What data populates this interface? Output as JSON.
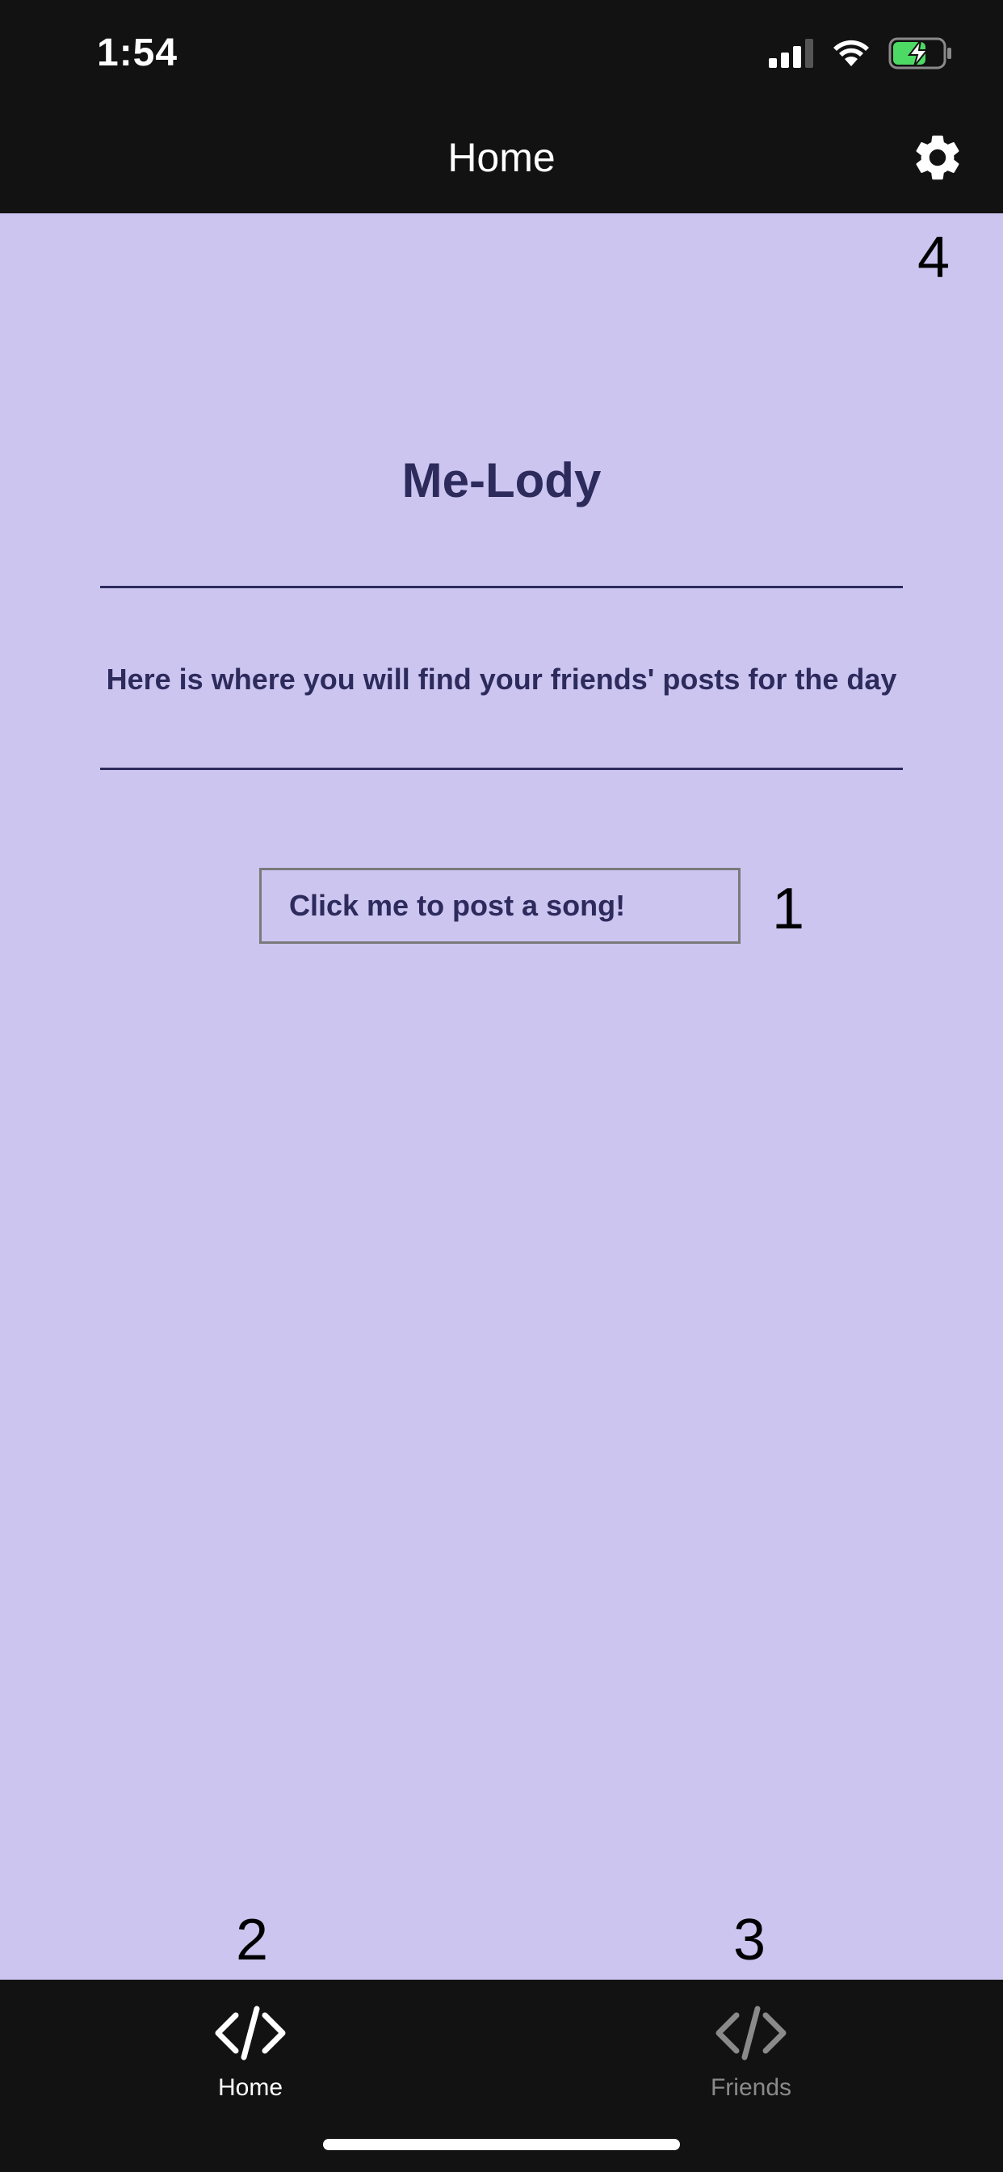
{
  "status_bar": {
    "time": "1:54",
    "icons": [
      "signal-icon",
      "wifi-icon",
      "battery-charging-icon"
    ]
  },
  "header": {
    "title": "Home",
    "settings_icon": "gear-icon"
  },
  "main": {
    "app_title": "Me-Lody",
    "subtitle": "Here is where you will find your friends' posts for the day",
    "post_button_label": "Click me to post a song!"
  },
  "markers": {
    "one": "1",
    "two": "2",
    "three": "3",
    "four": "4"
  },
  "tab_bar": {
    "tabs": [
      {
        "label": "Home",
        "icon": "code-icon",
        "active": true
      },
      {
        "label": "Friends",
        "icon": "code-icon",
        "active": false
      }
    ]
  },
  "colors": {
    "background": "#cbc5f0",
    "bar": "#121212",
    "text_primary": "#2d2a5c",
    "tab_active": "#ffffff",
    "tab_inactive": "#8a8a8a",
    "battery_green": "#4cd964"
  }
}
